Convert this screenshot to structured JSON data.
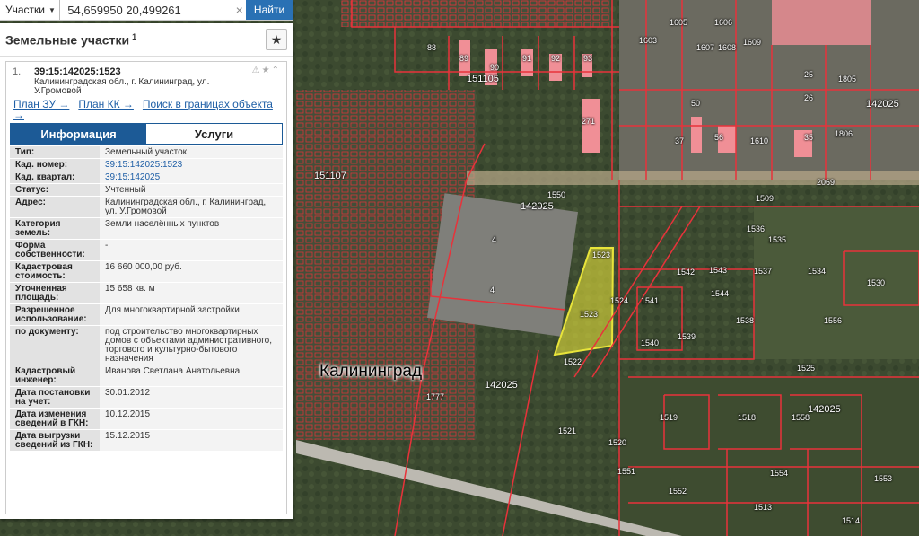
{
  "search": {
    "type_label": "Участки",
    "query": "54,659950 20,499261",
    "button_label": "Найти"
  },
  "panel": {
    "title": "Земельные участки",
    "count": "1"
  },
  "result": {
    "number": "1.",
    "cadastral_id": "39:15:142025:1523",
    "address": "Калининградская обл., г. Калининград, ул. У.Громовой",
    "links": [
      "План ЗУ →",
      "План КК →",
      "Поиск в границах объекта →"
    ]
  },
  "tabs": {
    "info": "Информация",
    "services": "Услуги"
  },
  "info_rows": [
    {
      "key": "Тип:",
      "value": "Земельный участок"
    },
    {
      "key": "Кад. номер:",
      "value": "39:15:142025:1523"
    },
    {
      "key": "Кад. квартал:",
      "value": "39:15:142025"
    },
    {
      "key": "Статус:",
      "value": "Учтенный"
    },
    {
      "key": "Адрес:",
      "value": "Калининградская обл., г. Калининград, ул. У.Громовой"
    },
    {
      "key": "Категория земель:",
      "value": "Земли населённых пунктов"
    },
    {
      "key": "Форма собственности:",
      "value": "-"
    },
    {
      "key": "Кадастровая стоимость:",
      "value": "16 660 000,00 руб."
    },
    {
      "key": "Уточненная площадь:",
      "value": "15 658 кв. м"
    },
    {
      "key": "Разрешенное использование:",
      "value": "Для многоквартирной застройки"
    },
    {
      "key": "по документу:",
      "value": "под строительство многоквартирных домов с объектами административного, торгового и культурно-бытового назначения"
    },
    {
      "key": "Кадастровый инженер:",
      "value": "Иванова Светлана Анатольевна"
    },
    {
      "key": "Дата постановки на учет:",
      "value": "30.01.2012"
    },
    {
      "key": "Дата изменения сведений в ГКН:",
      "value": "10.12.2015"
    },
    {
      "key": "Дата выгрузки сведений из ГКН:",
      "value": "15.12.2015"
    }
  ],
  "map": {
    "city_label": "Калининград",
    "quarters": [
      "151107",
      "142025",
      "142025",
      "142025",
      "151105",
      "142025"
    ],
    "parcels": [
      "1523",
      "1523",
      "1524",
      "1522",
      "1520",
      "1541",
      "1540",
      "1539",
      "1538",
      "1537",
      "1534",
      "1530",
      "1536",
      "1535",
      "1542",
      "1543",
      "1544",
      "1556",
      "1525",
      "1519",
      "1518",
      "1558",
      "1521",
      "1551",
      "1552",
      "1554",
      "1553",
      "1513",
      "1514",
      "1777",
      "1550",
      "1509",
      "2069",
      "1610",
      "1805",
      "1806",
      "1605",
      "1606",
      "1607",
      "1608",
      "1609",
      "1603",
      "89",
      "90",
      "91",
      "92",
      "93",
      "88",
      "271",
      "50",
      "56",
      "35",
      "37",
      "25",
      "26",
      "4",
      "4"
    ],
    "colors": {
      "parcel_line": "#e8323a",
      "selected_fill": "#e3e03a",
      "building_fill": "#f08f96"
    }
  }
}
